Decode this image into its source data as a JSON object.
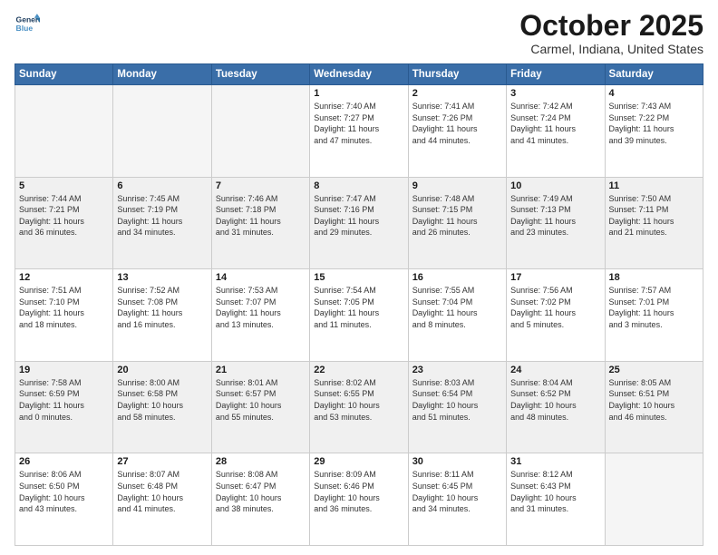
{
  "header": {
    "logo_general": "General",
    "logo_blue": "Blue",
    "month_title": "October 2025",
    "location": "Carmel, Indiana, United States"
  },
  "days_of_week": [
    "Sunday",
    "Monday",
    "Tuesday",
    "Wednesday",
    "Thursday",
    "Friday",
    "Saturday"
  ],
  "weeks": [
    [
      {
        "day": "",
        "info": ""
      },
      {
        "day": "",
        "info": ""
      },
      {
        "day": "",
        "info": ""
      },
      {
        "day": "1",
        "info": "Sunrise: 7:40 AM\nSunset: 7:27 PM\nDaylight: 11 hours\nand 47 minutes."
      },
      {
        "day": "2",
        "info": "Sunrise: 7:41 AM\nSunset: 7:26 PM\nDaylight: 11 hours\nand 44 minutes."
      },
      {
        "day": "3",
        "info": "Sunrise: 7:42 AM\nSunset: 7:24 PM\nDaylight: 11 hours\nand 41 minutes."
      },
      {
        "day": "4",
        "info": "Sunrise: 7:43 AM\nSunset: 7:22 PM\nDaylight: 11 hours\nand 39 minutes."
      }
    ],
    [
      {
        "day": "5",
        "info": "Sunrise: 7:44 AM\nSunset: 7:21 PM\nDaylight: 11 hours\nand 36 minutes."
      },
      {
        "day": "6",
        "info": "Sunrise: 7:45 AM\nSunset: 7:19 PM\nDaylight: 11 hours\nand 34 minutes."
      },
      {
        "day": "7",
        "info": "Sunrise: 7:46 AM\nSunset: 7:18 PM\nDaylight: 11 hours\nand 31 minutes."
      },
      {
        "day": "8",
        "info": "Sunrise: 7:47 AM\nSunset: 7:16 PM\nDaylight: 11 hours\nand 29 minutes."
      },
      {
        "day": "9",
        "info": "Sunrise: 7:48 AM\nSunset: 7:15 PM\nDaylight: 11 hours\nand 26 minutes."
      },
      {
        "day": "10",
        "info": "Sunrise: 7:49 AM\nSunset: 7:13 PM\nDaylight: 11 hours\nand 23 minutes."
      },
      {
        "day": "11",
        "info": "Sunrise: 7:50 AM\nSunset: 7:11 PM\nDaylight: 11 hours\nand 21 minutes."
      }
    ],
    [
      {
        "day": "12",
        "info": "Sunrise: 7:51 AM\nSunset: 7:10 PM\nDaylight: 11 hours\nand 18 minutes."
      },
      {
        "day": "13",
        "info": "Sunrise: 7:52 AM\nSunset: 7:08 PM\nDaylight: 11 hours\nand 16 minutes."
      },
      {
        "day": "14",
        "info": "Sunrise: 7:53 AM\nSunset: 7:07 PM\nDaylight: 11 hours\nand 13 minutes."
      },
      {
        "day": "15",
        "info": "Sunrise: 7:54 AM\nSunset: 7:05 PM\nDaylight: 11 hours\nand 11 minutes."
      },
      {
        "day": "16",
        "info": "Sunrise: 7:55 AM\nSunset: 7:04 PM\nDaylight: 11 hours\nand 8 minutes."
      },
      {
        "day": "17",
        "info": "Sunrise: 7:56 AM\nSunset: 7:02 PM\nDaylight: 11 hours\nand 5 minutes."
      },
      {
        "day": "18",
        "info": "Sunrise: 7:57 AM\nSunset: 7:01 PM\nDaylight: 11 hours\nand 3 minutes."
      }
    ],
    [
      {
        "day": "19",
        "info": "Sunrise: 7:58 AM\nSunset: 6:59 PM\nDaylight: 11 hours\nand 0 minutes."
      },
      {
        "day": "20",
        "info": "Sunrise: 8:00 AM\nSunset: 6:58 PM\nDaylight: 10 hours\nand 58 minutes."
      },
      {
        "day": "21",
        "info": "Sunrise: 8:01 AM\nSunset: 6:57 PM\nDaylight: 10 hours\nand 55 minutes."
      },
      {
        "day": "22",
        "info": "Sunrise: 8:02 AM\nSunset: 6:55 PM\nDaylight: 10 hours\nand 53 minutes."
      },
      {
        "day": "23",
        "info": "Sunrise: 8:03 AM\nSunset: 6:54 PM\nDaylight: 10 hours\nand 51 minutes."
      },
      {
        "day": "24",
        "info": "Sunrise: 8:04 AM\nSunset: 6:52 PM\nDaylight: 10 hours\nand 48 minutes."
      },
      {
        "day": "25",
        "info": "Sunrise: 8:05 AM\nSunset: 6:51 PM\nDaylight: 10 hours\nand 46 minutes."
      }
    ],
    [
      {
        "day": "26",
        "info": "Sunrise: 8:06 AM\nSunset: 6:50 PM\nDaylight: 10 hours\nand 43 minutes."
      },
      {
        "day": "27",
        "info": "Sunrise: 8:07 AM\nSunset: 6:48 PM\nDaylight: 10 hours\nand 41 minutes."
      },
      {
        "day": "28",
        "info": "Sunrise: 8:08 AM\nSunset: 6:47 PM\nDaylight: 10 hours\nand 38 minutes."
      },
      {
        "day": "29",
        "info": "Sunrise: 8:09 AM\nSunset: 6:46 PM\nDaylight: 10 hours\nand 36 minutes."
      },
      {
        "day": "30",
        "info": "Sunrise: 8:11 AM\nSunset: 6:45 PM\nDaylight: 10 hours\nand 34 minutes."
      },
      {
        "day": "31",
        "info": "Sunrise: 8:12 AM\nSunset: 6:43 PM\nDaylight: 10 hours\nand 31 minutes."
      },
      {
        "day": "",
        "info": ""
      }
    ]
  ],
  "shaded_rows": [
    1,
    3
  ]
}
